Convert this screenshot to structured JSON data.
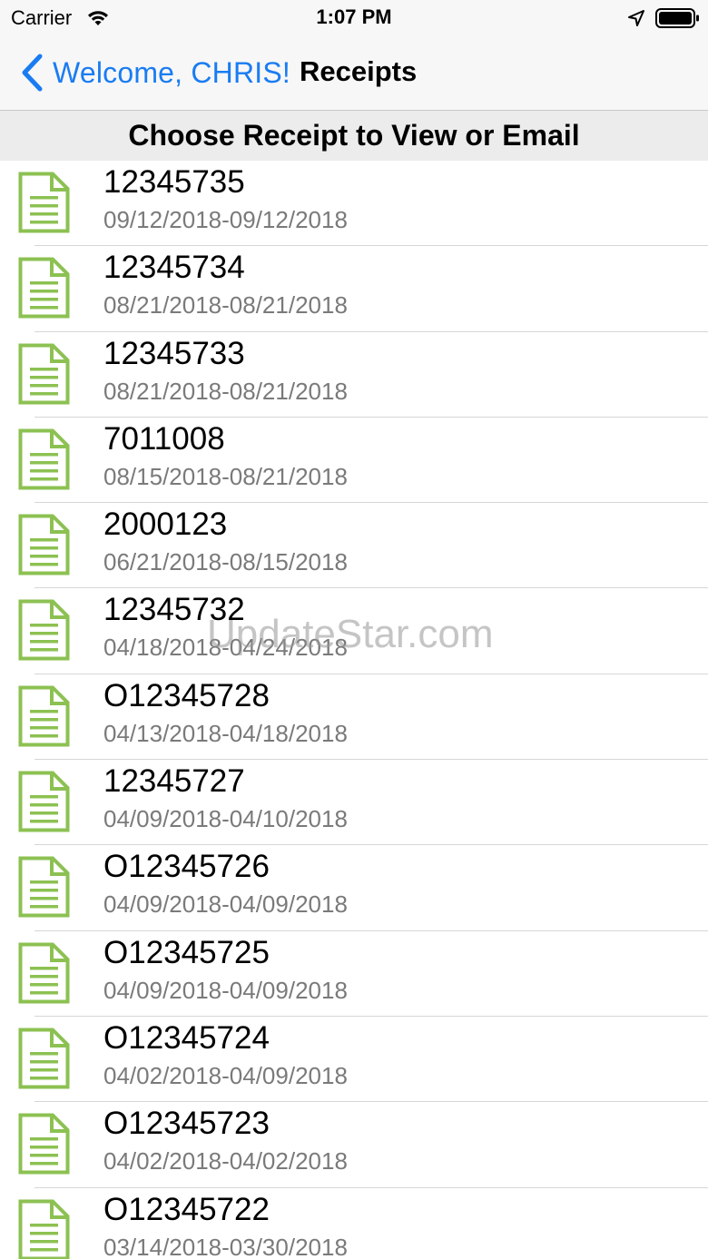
{
  "status_bar": {
    "carrier": "Carrier",
    "time": "1:07 PM",
    "icons": [
      "wifi-icon",
      "location-icon",
      "battery-icon"
    ]
  },
  "nav": {
    "back_label": "Welcome, CHRIS!",
    "title": "Receipts",
    "accent_color": "#1a7cf2"
  },
  "section_header": "Choose Receipt to View or Email",
  "receipts": [
    {
      "number": "12345735",
      "dates": "09/12/2018-09/12/2018"
    },
    {
      "number": "12345734",
      "dates": "08/21/2018-08/21/2018"
    },
    {
      "number": "12345733",
      "dates": "08/21/2018-08/21/2018"
    },
    {
      "number": "7011008",
      "dates": "08/15/2018-08/21/2018"
    },
    {
      "number": "2000123",
      "dates": "06/21/2018-08/15/2018"
    },
    {
      "number": "12345732",
      "dates": "04/18/2018-04/24/2018"
    },
    {
      "number": "O12345728",
      "dates": "04/13/2018-04/18/2018"
    },
    {
      "number": "12345727",
      "dates": "04/09/2018-04/10/2018"
    },
    {
      "number": "O12345726",
      "dates": "04/09/2018-04/09/2018"
    },
    {
      "number": "O12345725",
      "dates": "04/09/2018-04/09/2018"
    },
    {
      "number": "O12345724",
      "dates": "04/02/2018-04/09/2018"
    },
    {
      "number": "O12345723",
      "dates": "04/02/2018-04/02/2018"
    },
    {
      "number": "O12345722",
      "dates": "03/14/2018-03/30/2018"
    }
  ],
  "row_icon": "document-icon",
  "icon_color": "#8cc152",
  "watermark": "UpdateStar.com"
}
